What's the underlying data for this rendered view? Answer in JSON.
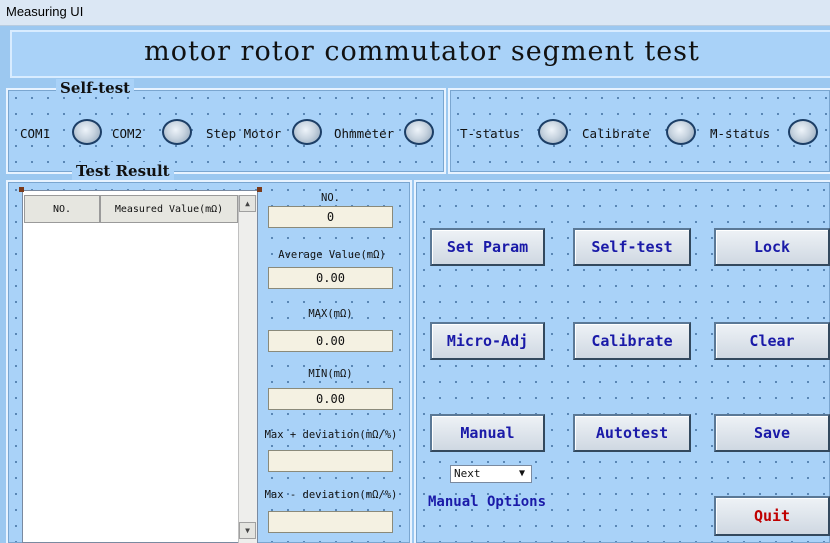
{
  "window": {
    "title": "Measuring UI"
  },
  "header": {
    "title": "motor rotor commutator segment test"
  },
  "self_test": {
    "legend": "Self-test",
    "indicators_left": [
      {
        "label": "COM1"
      },
      {
        "label": "COM2"
      },
      {
        "label": "Step Motor"
      },
      {
        "label": "Ohmmeter"
      }
    ],
    "indicators_right": [
      {
        "label": "T-status"
      },
      {
        "label": "Calibrate"
      },
      {
        "label": "M-status"
      }
    ]
  },
  "test_result": {
    "legend": "Test Result",
    "table": {
      "columns": [
        "NO.",
        "Measured Value(mΩ)"
      ],
      "rows": []
    },
    "fields": {
      "no_label": "NO.",
      "no_value": "0",
      "avg_label": "Average Value(mΩ)",
      "avg_value": "0.00",
      "max_label": "MAX(mΩ)",
      "max_value": "0.00",
      "min_label": "MIN(mΩ)",
      "min_value": "0.00",
      "max_plus_label": "Max + deviation(mΩ/%)",
      "max_plus_value": "",
      "max_minus_label": "Max - deviation(mΩ/%)",
      "max_minus_value": ""
    }
  },
  "controls": {
    "set_param": "Set Param",
    "self_test": "Self-test",
    "lock": "Lock",
    "micro_adj": "Micro-Adj",
    "calibrate": "Calibrate",
    "clear": "Clear",
    "manual": "Manual",
    "autotest": "Autotest",
    "save": "Save",
    "quit": "Quit",
    "manual_select": "Next",
    "manual_options_label": "Manual Options"
  }
}
